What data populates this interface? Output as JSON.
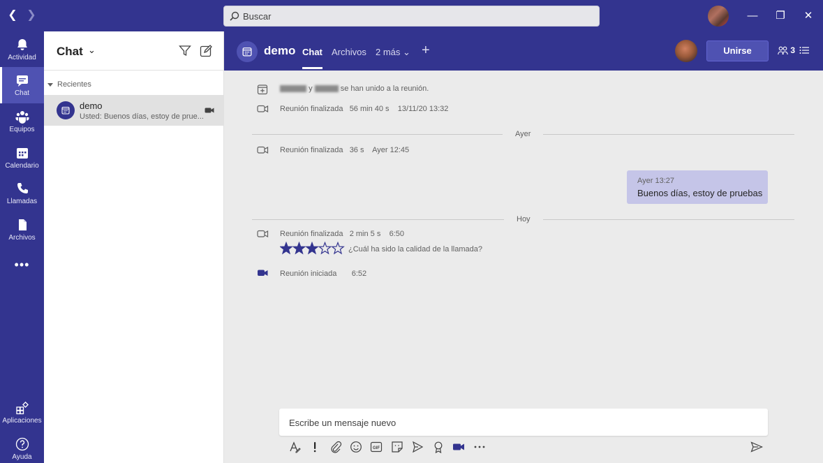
{
  "search": {
    "placeholder": "Buscar"
  },
  "rail": [
    {
      "label": "Actividad",
      "icon": "bell-icon"
    },
    {
      "label": "Chat",
      "icon": "chat-icon",
      "active": true
    },
    {
      "label": "Equipos",
      "icon": "teams-icon"
    },
    {
      "label": "Calendario",
      "icon": "calendar-icon"
    },
    {
      "label": "Llamadas",
      "icon": "phone-icon"
    },
    {
      "label": "Archivos",
      "icon": "files-icon"
    }
  ],
  "rail_bottom": [
    {
      "label": "Aplicaciones",
      "icon": "apps-icon"
    },
    {
      "label": "Ayuda",
      "icon": "help-icon"
    }
  ],
  "chatlist": {
    "title": "Chat",
    "section": "Recientes",
    "items": [
      {
        "name": "demo",
        "preview": "Usted: Buenos días, estoy de prue..."
      }
    ]
  },
  "header": {
    "title": "demo",
    "tabs": [
      "Chat",
      "Archivos",
      "2 más"
    ],
    "join_label": "Unirse",
    "participants": "3"
  },
  "feed": {
    "joined_conj": "y",
    "joined_suffix": "se han unido a la reunión.",
    "ended1": {
      "label": "Reunión finalizada",
      "duration": "56 min 40 s",
      "time": "13/11/20 13:32"
    },
    "day1": "Ayer",
    "ended2": {
      "label": "Reunión finalizada",
      "duration": "36 s",
      "time": "Ayer 12:45"
    },
    "message": {
      "time": "Ayer 13:27",
      "text": "Buenos días, estoy de pruebas"
    },
    "day2": "Hoy",
    "ended3": {
      "label": "Reunión finalizada",
      "duration": "2 min 5 s",
      "time": "6:50"
    },
    "rating": {
      "value": 3,
      "max": 5,
      "question": "¿Cuál ha sido la calidad de la llamada?"
    },
    "started": {
      "label": "Reunión iniciada",
      "time": "6:52"
    }
  },
  "composer": {
    "placeholder": "Escribe un mensaje nuevo"
  },
  "colors": {
    "brand": "#33348f",
    "accent": "#4f52b2",
    "star": "#33348f"
  }
}
